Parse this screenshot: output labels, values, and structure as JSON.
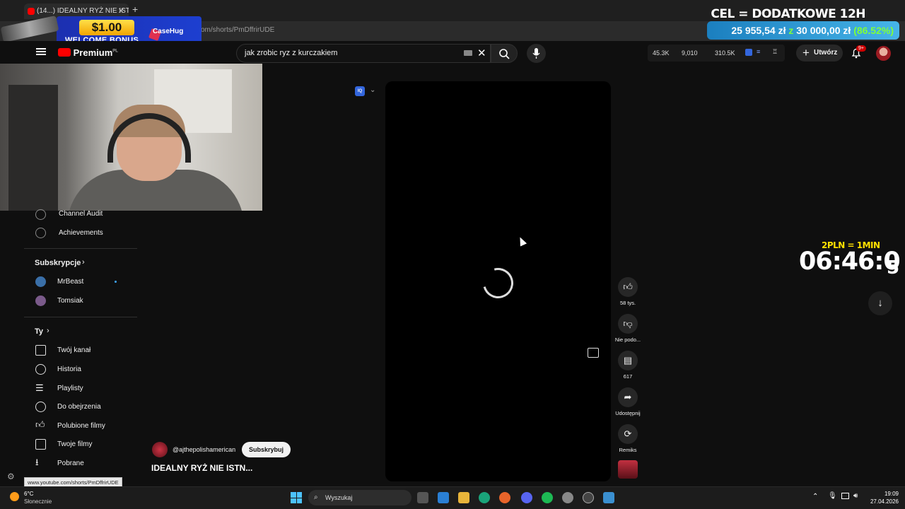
{
  "browser": {
    "tab_title": "(14...) IDEALNY RYŻ NIE ISTN...",
    "url": "om/shorts/PmDffrirUDE",
    "status_url": "www.youtube.com/shorts/PmDffrirUDE"
  },
  "promo": {
    "amount": "$1.00",
    "bonus_text": "WELCOME BONUS",
    "brand": "CaseHug"
  },
  "goal": {
    "title": "CEL = DODATKOWE 12H",
    "current": "25 955,54 zł",
    "sep": "z",
    "target": "30 000,00 zł",
    "percent": "(86.52%)"
  },
  "header": {
    "logo": "Premium",
    "logo_region": "PL",
    "search_value": "jak zrobic ryz z kurczakiem",
    "stats": {
      "a": "45.3K",
      "b": "9,010",
      "c": "310.5K"
    },
    "create_label": "Utwórz",
    "notif_badge": "9+"
  },
  "sidebar": {
    "tools": [
      {
        "label": "Channel Audit"
      },
      {
        "label": "Achievements"
      }
    ],
    "subs_header": "Subskrypcje",
    "subs": [
      {
        "label": "MrBeast",
        "avatar_color": "#3a6fa8"
      },
      {
        "label": "Tomsiak",
        "avatar_color": "#7a5a8a"
      }
    ],
    "you_header": "Ty",
    "you_items": [
      {
        "label": "Twój kanał",
        "icon": "account-icon"
      },
      {
        "label": "Historia",
        "icon": "history-icon"
      },
      {
        "label": "Playlisty",
        "icon": "playlist-icon"
      },
      {
        "label": "Do obejrzenia",
        "icon": "clock-icon"
      },
      {
        "label": "Polubione filmy",
        "icon": "thumb-up-icon"
      },
      {
        "label": "Twoje filmy",
        "icon": "video-icon"
      },
      {
        "label": "Pobrane",
        "icon": "download-icon"
      }
    ]
  },
  "video": {
    "channel": "@ajthepolishamerican",
    "subscribe_label": "Subskrybuj",
    "title": "IDEALNY RYŻ NIE ISTN...",
    "extension_label": "IQ"
  },
  "actions": {
    "likes": "58 tys.",
    "dislike": "Nie podo...",
    "comments": "617",
    "share": "Udostępnij",
    "remix": "Remiks"
  },
  "overlay": {
    "rate": "2PLN = 1MIN",
    "timer": "06:46:0",
    "timer_last": "5"
  },
  "taskbar": {
    "temp": "6°C",
    "condition": "Słonecznie",
    "search_label": "Wyszukaj",
    "time": "19:09",
    "date": "27.04.2026"
  },
  "colors": {
    "accent_red": "#ff0000",
    "goal_green": "#7fff3a",
    "rate_yellow": "#ffe000"
  }
}
